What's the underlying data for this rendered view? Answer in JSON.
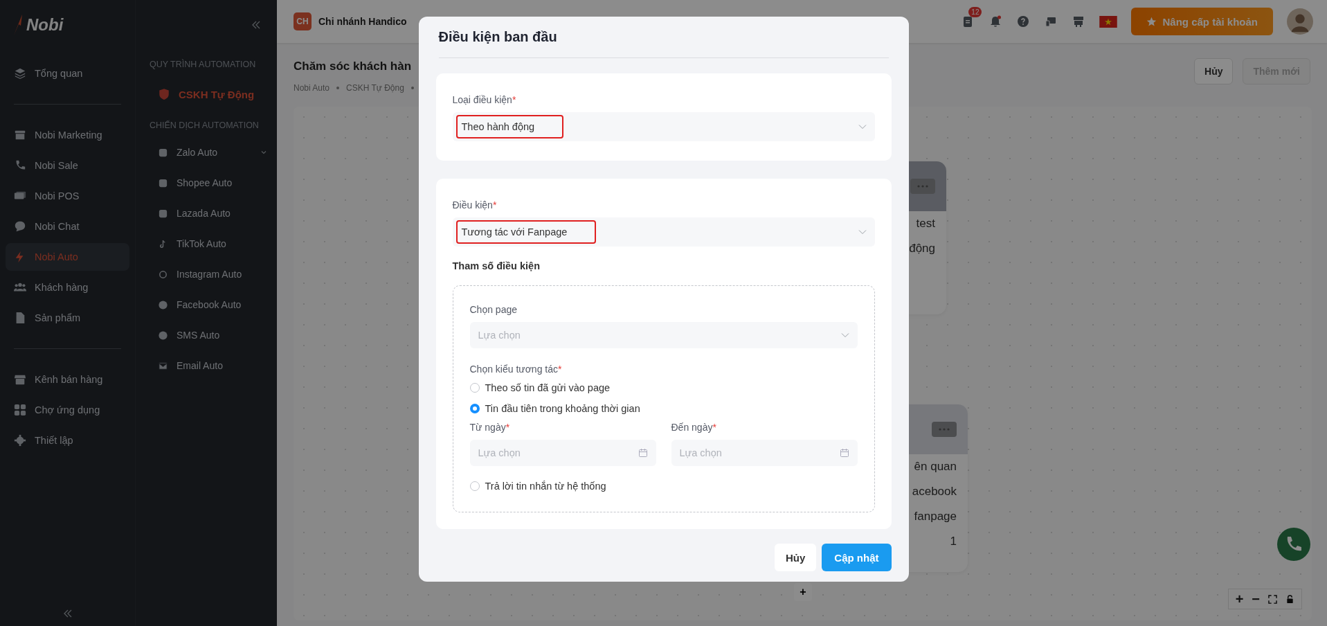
{
  "sidebar": {
    "logo": "Nobi",
    "nav_groups": [
      [
        {
          "label": "Tổng quan",
          "selected": false
        }
      ],
      [
        {
          "label": "Nobi Marketing",
          "selected": false
        },
        {
          "label": "Nobi Sale",
          "selected": false
        },
        {
          "label": "Nobi POS",
          "selected": false
        },
        {
          "label": "Nobi Chat",
          "selected": false
        },
        {
          "label": "Nobi Auto",
          "selected": true
        },
        {
          "label": "Khách hàng",
          "selected": false
        },
        {
          "label": "Sản phẩm",
          "selected": false
        }
      ],
      [
        {
          "label": "Kênh bán hàng",
          "selected": false
        },
        {
          "label": "Chợ ứng dụng",
          "selected": false
        },
        {
          "label": "Thiết lập",
          "selected": false
        }
      ]
    ]
  },
  "subnav": {
    "sections": [
      {
        "title": "QUY TRÌNH AUTOMATION",
        "items": [
          {
            "label": "CSKH Tự Động",
            "selected": true,
            "expandable": false
          }
        ]
      },
      {
        "title": "CHIẾN DỊCH AUTOMATION",
        "items": [
          {
            "label": "Zalo Auto",
            "selected": false,
            "expandable": true
          },
          {
            "label": "Shopee Auto",
            "selected": false,
            "expandable": false
          },
          {
            "label": "Lazada Auto",
            "selected": false,
            "expandable": false
          },
          {
            "label": "TikTok Auto",
            "selected": false,
            "expandable": false
          },
          {
            "label": "Instagram Auto",
            "selected": false,
            "expandable": false
          },
          {
            "label": "Facebook Auto",
            "selected": false,
            "expandable": false
          },
          {
            "label": "SMS Auto",
            "selected": false,
            "expandable": false
          },
          {
            "label": "Email Auto",
            "selected": false,
            "expandable": false
          }
        ]
      }
    ]
  },
  "topbar": {
    "branch_initials": "CH",
    "branch_name": "Chi nhánh Handico",
    "task_count": "12",
    "upgrade_button": "Nâng cấp tài khoản"
  },
  "page": {
    "title": "Chăm sóc khách hàn",
    "breadcrumbs": [
      "Nobi Auto",
      "CSKH Tự Động"
    ],
    "buttons": [
      {
        "label": "Hủy",
        "disabled": false
      },
      {
        "label": "Thêm mới",
        "disabled": true
      }
    ]
  },
  "canvas": {
    "nodes": [
      {
        "lines": [
          "test",
          "động"
        ]
      },
      {
        "lines": [
          "ên quan",
          "acebook",
          "fanpage",
          "1"
        ]
      }
    ],
    "add_button": "+",
    "zoom_in": "+",
    "zoom_out": "−"
  },
  "modal": {
    "title": "Điều kiện ban đầu",
    "condition_type": {
      "label": "Loại điều kiện",
      "required_mark": "*",
      "value": "Theo hành động",
      "highlighted": true
    },
    "condition": {
      "label": "Điều kiện",
      "required_mark": "*",
      "value": "Tương tác với Fanpage",
      "highlighted": true
    },
    "params_title": "Tham số điều kiện",
    "page_select": {
      "label": "Chọn page",
      "placeholder": "Lựa chọn"
    },
    "interaction_label": {
      "label": "Chọn kiểu tương tác",
      "required_mark": "*"
    },
    "interaction_types": [
      {
        "label": "Theo số tin đã gửi vào page",
        "selected": false
      },
      {
        "label": "Tin đầu tiên trong khoảng thời gian",
        "selected": true
      }
    ],
    "from_date": {
      "label": "Từ ngày",
      "required_mark": "*",
      "placeholder": "Lựa chọn"
    },
    "to_date": {
      "label": "Đến ngày",
      "required_mark": "*",
      "placeholder": "Lựa chọn"
    },
    "reply_option": {
      "label": "Trả lời tin nhắn từ hệ thống",
      "selected": false
    },
    "cancel_button": "Hủy",
    "submit_button": "Cập nhật"
  }
}
